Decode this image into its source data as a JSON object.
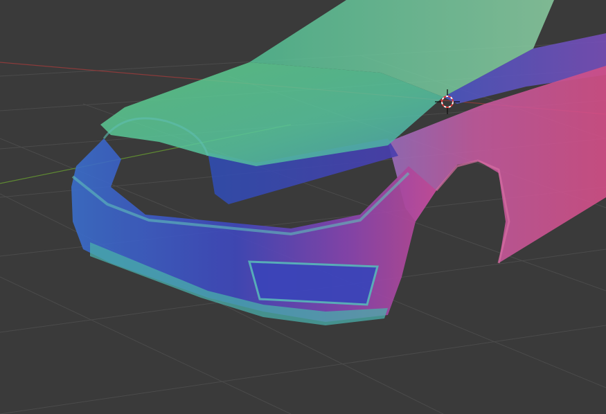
{
  "viewport": {
    "background": "#3a3a3a",
    "grid_color": "#4a4a4a",
    "x_axis_color": "#8a3b3b",
    "y_axis_color": "#5f8a32"
  },
  "model": {
    "shading": "normal-map",
    "colors": {
      "green": "#5ccf8f",
      "teal": "#4fb7a8",
      "blue": "#3e56c6",
      "violet": "#6b45b8",
      "magenta": "#c94fa0",
      "pink": "#d65a96"
    }
  },
  "icons": {
    "cursor": "3d-cursor-icon"
  }
}
